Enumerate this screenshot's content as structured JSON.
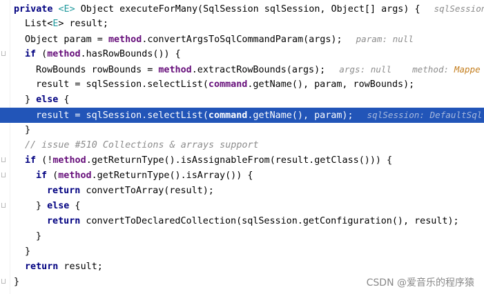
{
  "code": {
    "signature": {
      "kw": "private ",
      "generic": "<E>",
      "mid": " Object executeForMany(SqlSession sqlSession, Object[] args) {",
      "hint": "sqlSession"
    },
    "l2": {
      "a": "List<",
      "g": "E",
      "b": "> result;"
    },
    "l3": {
      "a": "Object param = ",
      "f": "method",
      "b": ".convertArgsToSqlCommandParam(args);",
      "hint": "param: null"
    },
    "l4": {
      "kw": "if",
      "a": " (",
      "f": "method",
      "b": ".hasRowBounds()) {"
    },
    "l5": {
      "a": "RowBounds rowBounds = ",
      "f": "method",
      "b": ".extractRowBounds(args);",
      "hint1": "args: null",
      "hint2": "method: ",
      "hint3": "Mappe"
    },
    "l6": {
      "a": "result = sqlSession.selectList(",
      "f": "command",
      "b": ".getName(), param, rowBounds);"
    },
    "l7": {
      "a": "} ",
      "kw": "else",
      "b": " {"
    },
    "l8": {
      "a": "result = sqlSession.selectList(",
      "f": "command",
      "b": ".getName(), param);",
      "hint": "sqlSession: DefaultSql"
    },
    "l9": {
      "a": "}"
    },
    "l10": {
      "comment": "// issue #510 Collections & arrays support"
    },
    "l11": {
      "kw": "if",
      "a": " (!",
      "f": "method",
      "b": ".getReturnType().isAssignableFrom(result.getClass())) {"
    },
    "l12": {
      "kw": "if",
      "a": " (",
      "f": "method",
      "b": ".getReturnType().isArray()) {"
    },
    "l13": {
      "kw": "return",
      "a": " convertToArray(result);"
    },
    "l14": {
      "a": "} ",
      "kw": "else",
      "b": " {"
    },
    "l15": {
      "kw": "return",
      "a": " convertToDeclaredCollection(sqlSession.getConfiguration(), result);"
    },
    "l16": {
      "a": "}"
    },
    "l17": {
      "a": "}"
    },
    "l18": {
      "kw": "return",
      "a": " result;"
    },
    "l19": {
      "a": "}"
    }
  },
  "watermark": "CSDN @爱音乐的程序猿",
  "colors": {
    "keyword": "#000080",
    "field": "#660e7a",
    "generic": "#20999d",
    "comment": "#8c8c8c",
    "highlight": "#2255b8"
  }
}
